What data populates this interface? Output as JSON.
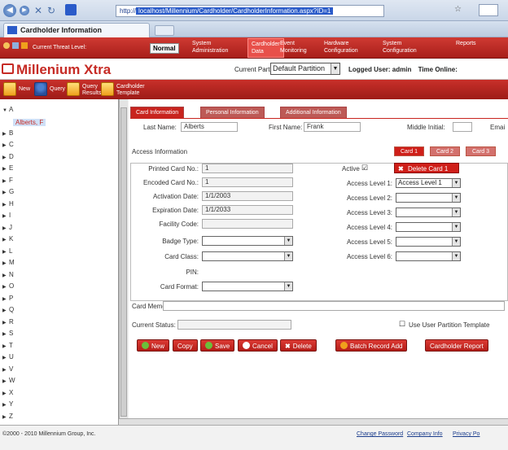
{
  "browser": {
    "url_prefix": "http://",
    "url_highlight": "localhost/Millennium/Cardholder/CardholderInformation.aspx?ID=1",
    "tab_title": "Cardholder Information"
  },
  "appnav": {
    "items": [
      {
        "label": "Current Threat Level:"
      },
      {
        "label": "System\nAdministration"
      },
      {
        "label": "Cardholder\nData"
      },
      {
        "label": "Event\nMonitoring"
      },
      {
        "label": "Hardware\nConfiguration"
      },
      {
        "label": "System\nConfiguration"
      },
      {
        "label": "Reports"
      }
    ],
    "threat_level": "Normal"
  },
  "brand": {
    "logo": "Millenium Xtra",
    "partition_label": "Current Partition:",
    "partition_value": "Default Partition",
    "logged_user": "Logged User: admin",
    "time_online": "Time Online:"
  },
  "toolbar": {
    "items": [
      "New",
      "Query",
      "Query\nResults",
      "Cardholder\nTemplate"
    ]
  },
  "tree": {
    "letters": [
      "A",
      "B",
      "C",
      "D",
      "E",
      "F",
      "G",
      "H",
      "I",
      "J",
      "K",
      "L",
      "M",
      "N",
      "O",
      "P",
      "Q",
      "R",
      "S",
      "T",
      "U",
      "V",
      "W",
      "X",
      "Y",
      "Z"
    ],
    "selected_child": "Alberts, F"
  },
  "tabs": [
    "Card Information",
    "Personal Information",
    "Additional Information"
  ],
  "form": {
    "last_name_label": "Last Name:",
    "last_name": "Alberts",
    "first_name_label": "First Name:",
    "first_name": "Frank",
    "middle_initial_label": "Middle Initial:",
    "email_label": "Emai",
    "access_info_label": "Access Information",
    "card_tabs": [
      "Card 1",
      "Card 2",
      "Card 3"
    ],
    "printed_card_label": "Printed Card No.:",
    "printed_card": "1",
    "encoded_card_label": "Encoded Card No.:",
    "encoded_card": "1",
    "activation_label": "Activation Date:",
    "activation": "1/1/2003",
    "expiration_label": "Expiration Date:",
    "expiration": "1/1/2033",
    "facility_label": "Facility Code:",
    "badge_label": "Badge Type:",
    "card_class_label": "Card Class:",
    "pin_label": "PIN:",
    "card_format_label": "Card Format:",
    "active_label": "Active",
    "delete_card": "Delete Card 1",
    "access_level_labels": [
      "Access Level 1:",
      "Access Level 2:",
      "Access Level 3:",
      "Access Level 4:",
      "Access Level 5:",
      "Access Level 6:"
    ],
    "access_level_1": "Access Level 1",
    "card_memo_label": "Card Memo:",
    "status_label": "Current Status:",
    "partition_template_label": "Use User Partition Template"
  },
  "actions": [
    "New",
    "Copy",
    "Save",
    "Cancel",
    "Delete",
    "Batch Record Add",
    "Cardholder Report"
  ],
  "footer": {
    "copyright": "©2000 - 2010 Millennium Group, Inc.",
    "links": [
      "Change Password",
      "Company Info",
      "Privacy Po"
    ]
  },
  "colors": {
    "brand_red": "#c62b25",
    "toolbar_red": "#b41d18"
  }
}
